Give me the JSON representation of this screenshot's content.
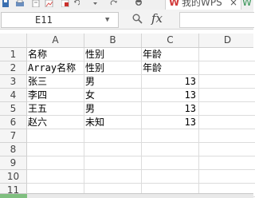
{
  "toolbar": {
    "tab_title": "我的WPS",
    "tab_close": "×",
    "tab_next_partial": "W"
  },
  "formula_bar": {
    "name_box": "E11",
    "fx": "fx",
    "formula": ""
  },
  "columns": [
    "A",
    "B",
    "C",
    "D"
  ],
  "rows": [
    "1",
    "2",
    "3",
    "4",
    "5",
    "6",
    "7",
    "8",
    "9",
    "10",
    "11"
  ],
  "cells": [
    [
      "名称",
      "性别",
      "年龄",
      ""
    ],
    [
      "Array名称",
      "性别",
      "年龄",
      ""
    ],
    [
      "张三",
      "男",
      "13",
      ""
    ],
    [
      "李四",
      "女",
      "13",
      ""
    ],
    [
      "王五",
      "男",
      "13",
      ""
    ],
    [
      "赵六",
      "未知",
      "13",
      ""
    ],
    [
      "",
      "",
      "",
      ""
    ],
    [
      "",
      "",
      "",
      ""
    ],
    [
      "",
      "",
      "",
      ""
    ],
    [
      "",
      "",
      "",
      ""
    ],
    [
      "",
      "",
      "",
      ""
    ]
  ],
  "colors": {
    "wps_red": "#d23b3b",
    "sheet_tab_green": "#7fbf7f"
  }
}
